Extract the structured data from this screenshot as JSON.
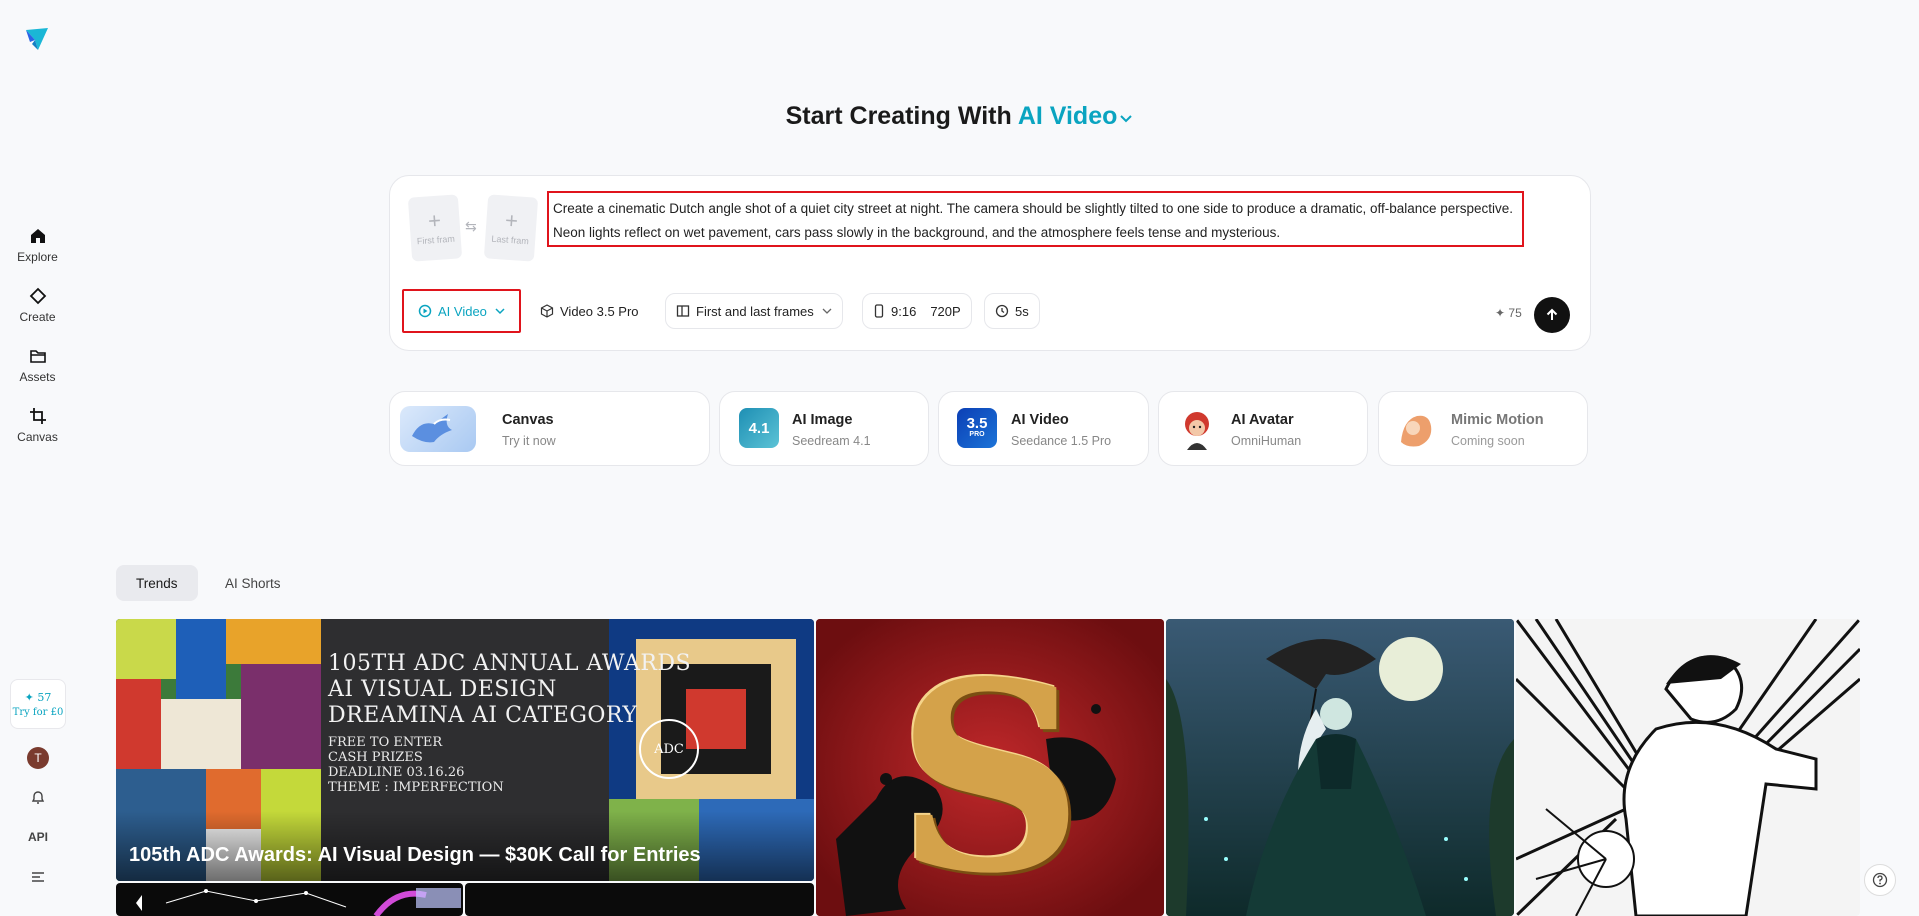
{
  "sidebar": {
    "items": [
      {
        "label": "Explore",
        "icon": "home-icon"
      },
      {
        "label": "Create",
        "icon": "diamond-icon"
      },
      {
        "label": "Assets",
        "icon": "folder-icon"
      },
      {
        "label": "Canvas",
        "icon": "crop-icon"
      }
    ],
    "credits": {
      "value": "✦ 57",
      "cta": "Try for £0"
    },
    "avatar_initial": "T",
    "api_label": "API"
  },
  "heading": {
    "prefix": "Start Creating With",
    "mode": "AI Video"
  },
  "prompt": {
    "first_frame_label": "First fram",
    "last_frame_label": "Last fram",
    "text": "Create a cinematic Dutch angle shot of a quiet city street at night. The camera should be slightly tilted to one side to produce a dramatic, off-balance perspective. Neon lights reflect on wet pavement, cars pass slowly in the background, and the atmosphere feels tense and mysterious.",
    "toolbar": {
      "mode": "AI Video",
      "model": "Video 3.5 Pro",
      "frames": "First and last frames",
      "ratio": "9:16",
      "resolution": "720P",
      "duration": "5s",
      "cost": "✦ 75"
    }
  },
  "tools": [
    {
      "title": "Canvas",
      "subtitle": "Try it now"
    },
    {
      "title": "AI Image",
      "subtitle": "Seedream 4.1",
      "badge": "4.1"
    },
    {
      "title": "AI Video",
      "subtitle": "Seedance 1.5 Pro",
      "badge": "3.5",
      "badge_sub": "PRO"
    },
    {
      "title": "AI Avatar",
      "subtitle": "OmniHuman"
    },
    {
      "title": "Mimic Motion",
      "subtitle": "Coming soon"
    }
  ],
  "tabs": [
    {
      "label": "Trends",
      "active": true
    },
    {
      "label": "AI Shorts",
      "active": false
    }
  ],
  "gallery": {
    "featured_caption": "105th ADC Awards: AI Visual Design — $30K Call for Entries",
    "poster_lines": [
      "105TH ADC ANNUAL AWARDS",
      "AI VISUAL DESIGN",
      "DREAMINA AI CATEGORY"
    ],
    "poster_details": [
      "FREE TO ENTER",
      "CASH PRIZES",
      "DEADLINE 03.16.26",
      "THEME : IMPERFECTION"
    ],
    "poster_logo": "ADC",
    "letter_art": "S"
  },
  "colors": {
    "accent": "#0aa4c0",
    "highlight": "#e0141c",
    "background": "#f8f9fb"
  }
}
